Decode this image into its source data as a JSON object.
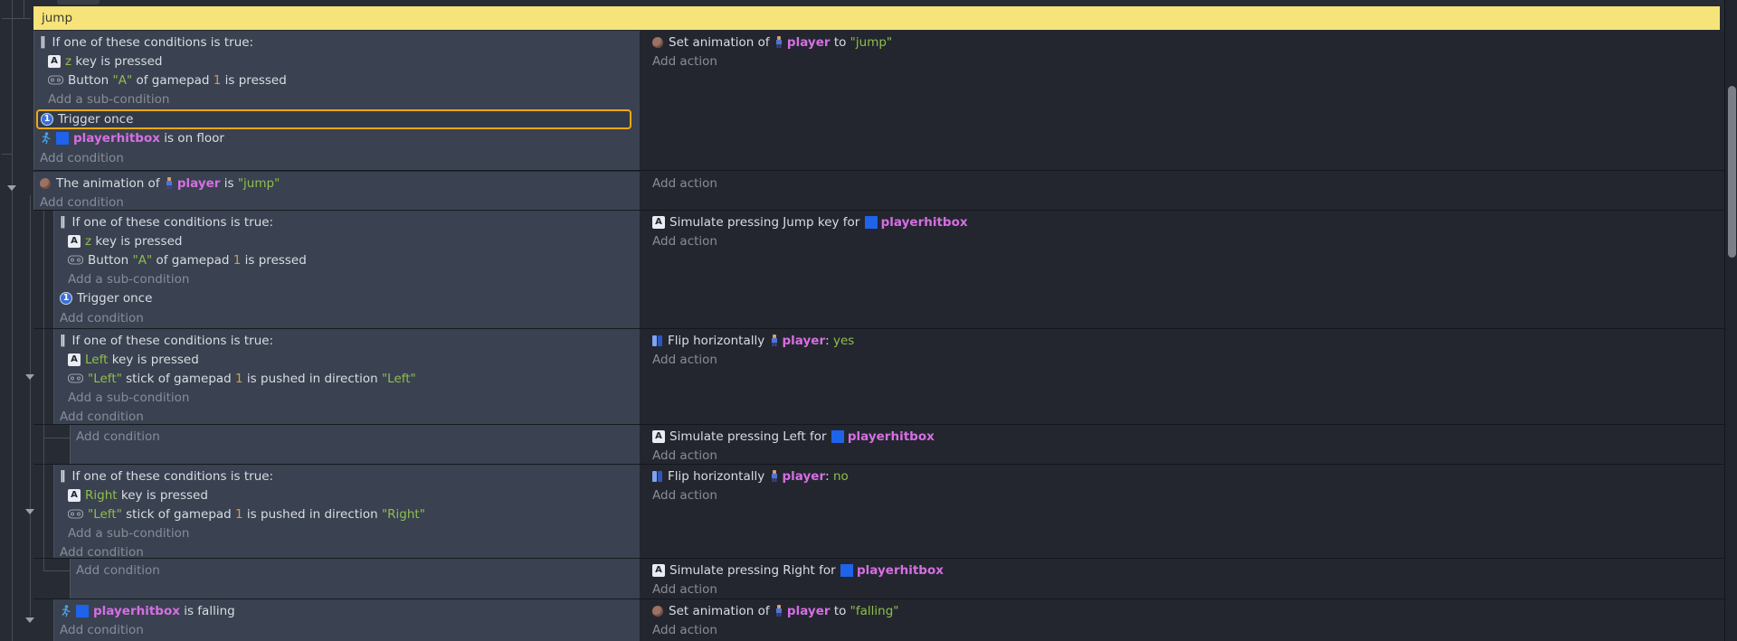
{
  "comment": {
    "text": "jump"
  },
  "icons": {
    "or": "‖",
    "key": "A",
    "once": "1"
  },
  "links": {
    "add_condition": "Add condition",
    "add_sub": "Add a sub-condition",
    "add_action": "Add action"
  },
  "events": {
    "e1": {
      "if_or": [
        {
          "t": "If one of these conditions is true:"
        }
      ],
      "z_key": [
        {
          "t": "z",
          "c": "g"
        },
        {
          "t": " key is pressed"
        }
      ],
      "pad_a": [
        {
          "t": "Button "
        },
        {
          "t": "\"A\"",
          "c": "g"
        },
        {
          "t": " of gamepad "
        },
        {
          "t": "1",
          "c": "o"
        },
        {
          "t": " is pressed"
        }
      ],
      "trigger": [
        {
          "t": "Trigger once"
        }
      ],
      "floor": [
        {
          "t": "playerhitbox",
          "c": "m"
        },
        {
          "t": " is on floor"
        }
      ],
      "set_anim_pre": [
        {
          "t": "Set animation of "
        }
      ],
      "set_anim_obj": [
        {
          "t": "player",
          "c": "m"
        },
        {
          "t": " to "
        },
        {
          "t": "\"jump\"",
          "c": "g"
        }
      ]
    },
    "e2": {
      "anim_is_pre": [
        {
          "t": "The animation of "
        }
      ],
      "anim_is_obj": [
        {
          "t": "player",
          "c": "m"
        },
        {
          "t": " is "
        },
        {
          "t": "\"jump\"",
          "c": "g"
        }
      ]
    },
    "e21": {
      "if_or": [
        {
          "t": "If one of these conditions is true:"
        }
      ],
      "z_key": [
        {
          "t": "z",
          "c": "g"
        },
        {
          "t": " key is pressed"
        }
      ],
      "pad_a": [
        {
          "t": "Button "
        },
        {
          "t": "\"A\"",
          "c": "g"
        },
        {
          "t": " of gamepad "
        },
        {
          "t": "1",
          "c": "o"
        },
        {
          "t": " is pressed"
        }
      ],
      "trigger": [
        {
          "t": "Trigger once"
        }
      ],
      "sim_jump": [
        {
          "t": "Simulate pressing Jump key for "
        }
      ],
      "sim_obj": [
        {
          "t": "playerhitbox",
          "c": "m"
        }
      ]
    },
    "e22": {
      "if_or": [
        {
          "t": "If one of these conditions is true:"
        }
      ],
      "left_key": [
        {
          "t": "Left",
          "c": "g"
        },
        {
          "t": " key is pressed"
        }
      ],
      "stick": [
        {
          "t": "\"Left\"",
          "c": "g"
        },
        {
          "t": " stick of gamepad "
        },
        {
          "t": "1",
          "c": "o"
        },
        {
          "t": " is pushed in direction "
        },
        {
          "t": "\"Left\"",
          "c": "g"
        }
      ],
      "flip_pre": [
        {
          "t": "Flip horizontally "
        }
      ],
      "flip_obj": [
        {
          "t": "player",
          "c": "m"
        },
        {
          "t": ": "
        },
        {
          "t": "yes",
          "c": "g"
        }
      ]
    },
    "e221": {
      "sim_left": [
        {
          "t": "Simulate pressing Left for "
        }
      ],
      "sim_obj": [
        {
          "t": "playerhitbox",
          "c": "m"
        }
      ]
    },
    "e23": {
      "if_or": [
        {
          "t": "If one of these conditions is true:"
        }
      ],
      "right_key": [
        {
          "t": "Right",
          "c": "g"
        },
        {
          "t": " key is pressed"
        }
      ],
      "stick": [
        {
          "t": "\"Left\"",
          "c": "g"
        },
        {
          "t": " stick of gamepad "
        },
        {
          "t": "1",
          "c": "o"
        },
        {
          "t": " is pushed in direction "
        },
        {
          "t": "\"Right\"",
          "c": "g"
        }
      ],
      "flip_pre": [
        {
          "t": "Flip horizontally "
        }
      ],
      "flip_obj": [
        {
          "t": "player",
          "c": "m"
        },
        {
          "t": ": "
        },
        {
          "t": "no",
          "c": "g"
        }
      ]
    },
    "e231": {
      "sim_right": [
        {
          "t": "Simulate pressing Right for "
        }
      ],
      "sim_obj": [
        {
          "t": "playerhitbox",
          "c": "m"
        }
      ]
    },
    "e24": {
      "falling": [
        {
          "t": "playerhitbox",
          "c": "m"
        },
        {
          "t": " is falling"
        }
      ],
      "set_anim_pre": [
        {
          "t": "Set animation of "
        }
      ],
      "set_anim_obj": [
        {
          "t": "player",
          "c": "m"
        },
        {
          "t": " to "
        },
        {
          "t": "\"falling\"",
          "c": "g"
        }
      ]
    }
  }
}
